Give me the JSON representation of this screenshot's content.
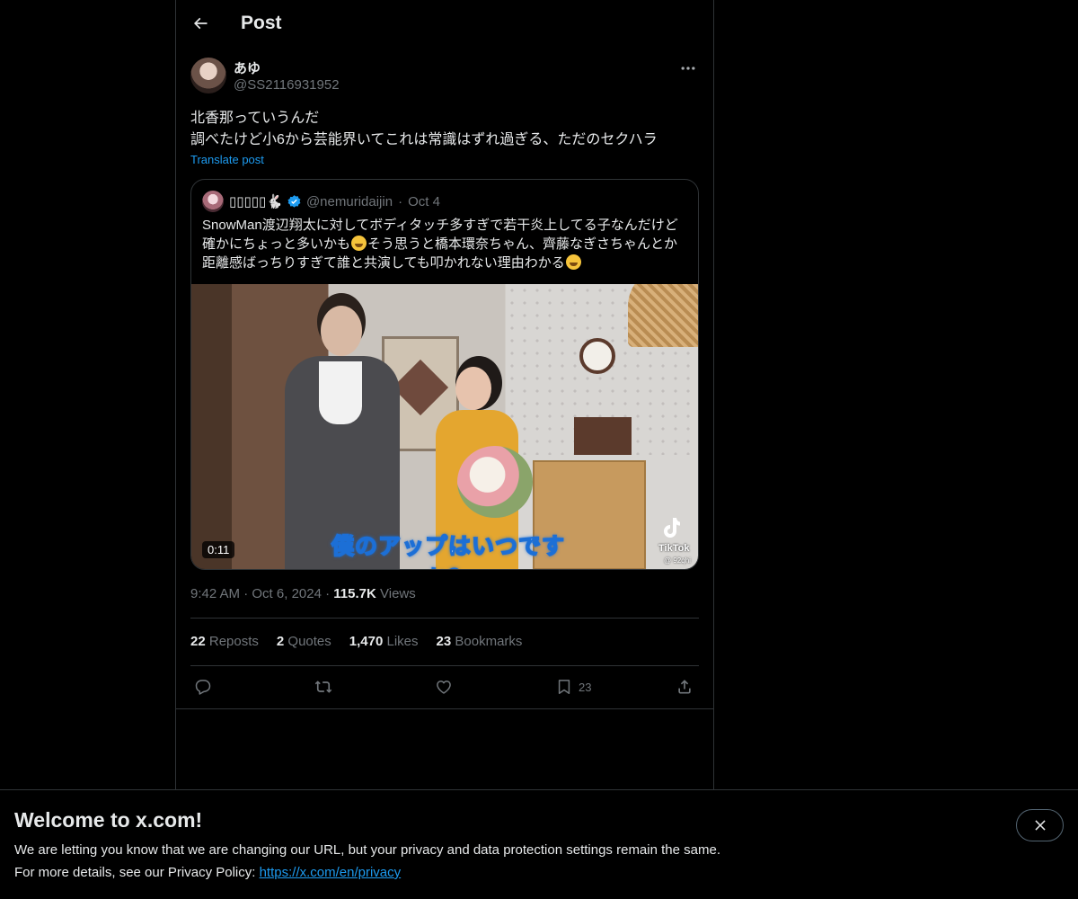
{
  "header": {
    "title": "Post"
  },
  "post": {
    "author_name": "あゆ",
    "author_handle": "@SS2116931952",
    "text": "北香那っていうんだ\n調べたけど小6から芸能界いてこれは常識はずれ過ぎる、ただのセクハラ",
    "translate_label": "Translate post",
    "time": "9:42 AM",
    "date": "Oct 6, 2024",
    "views_count": "115.7K",
    "views_label": "Views"
  },
  "quote": {
    "author_name": "▯▯▯▯▯🐇",
    "author_handle": "@nemuridaijin",
    "date": "Oct 4",
    "text_part1": "SnowMan渡辺翔太に対してボディタッチ多すぎで若干炎上してる子なんだけど\n確かにちょっと多いかも",
    "text_part2": "そう思うと橋本環奈ちゃん、齊藤なぎさちゃんとか\n距離感ばっちりすぎて誰と共演しても叩かれない理由わかる",
    "video_duration": "0:11",
    "video_caption": "僕のアップはいつですか？",
    "watermark_label": "TikTok",
    "watermark_handle": "@ 92qhi"
  },
  "stats": {
    "reposts_count": "22",
    "reposts_label": "Reposts",
    "quotes_count": "2",
    "quotes_label": "Quotes",
    "likes_count": "1,470",
    "likes_label": "Likes",
    "bookmarks_count": "23",
    "bookmarks_label": "Bookmarks"
  },
  "actions": {
    "bookmark_count": "23"
  },
  "banner": {
    "title": "Welcome to x.com!",
    "line1": "We are letting you know that we are changing our URL, but your privacy and data protection settings remain the same.",
    "line2_prefix": "For more details, see our Privacy Policy: ",
    "link": "https://x.com/en/privacy"
  },
  "colors": {
    "background": "#000000",
    "text_primary": "#e7e9ea",
    "text_secondary": "#71767b",
    "accent": "#1d9bf0",
    "border": "#2f3336"
  },
  "icons": [
    "back-arrow-icon",
    "more-icon",
    "verified-icon",
    "reply-icon",
    "repost-icon",
    "like-icon",
    "bookmark-icon",
    "share-icon",
    "close-icon",
    "tiktok-icon"
  ]
}
